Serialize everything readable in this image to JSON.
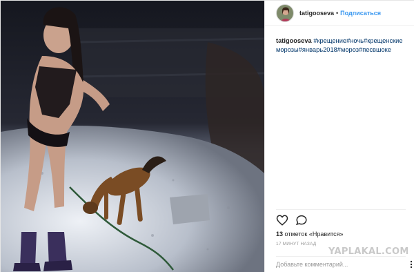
{
  "header": {
    "username": "tatigooseva",
    "separator": "•",
    "follow_label": "Подписаться"
  },
  "caption": {
    "username": "tatigooseva",
    "hashtags": [
      "#крещение",
      "#ночь",
      "#крещенские морозы",
      "#январь2018",
      "#мороз",
      "#песвшоке"
    ]
  },
  "actions": {
    "like_icon": "heart-outline",
    "comment_icon": "speech-bubble"
  },
  "likes": {
    "count": "13",
    "text": "отметок «Нравится»"
  },
  "timestamp": "17 МИНУТ НАЗАД",
  "watermark": "YAPLAKAL.COM",
  "comment": {
    "placeholder": "Добавьте комментарий..."
  },
  "colors": {
    "link_blue": "#3897f0",
    "hashtag": "#003569",
    "text": "#262626",
    "muted": "#999999",
    "border": "#efefef"
  }
}
